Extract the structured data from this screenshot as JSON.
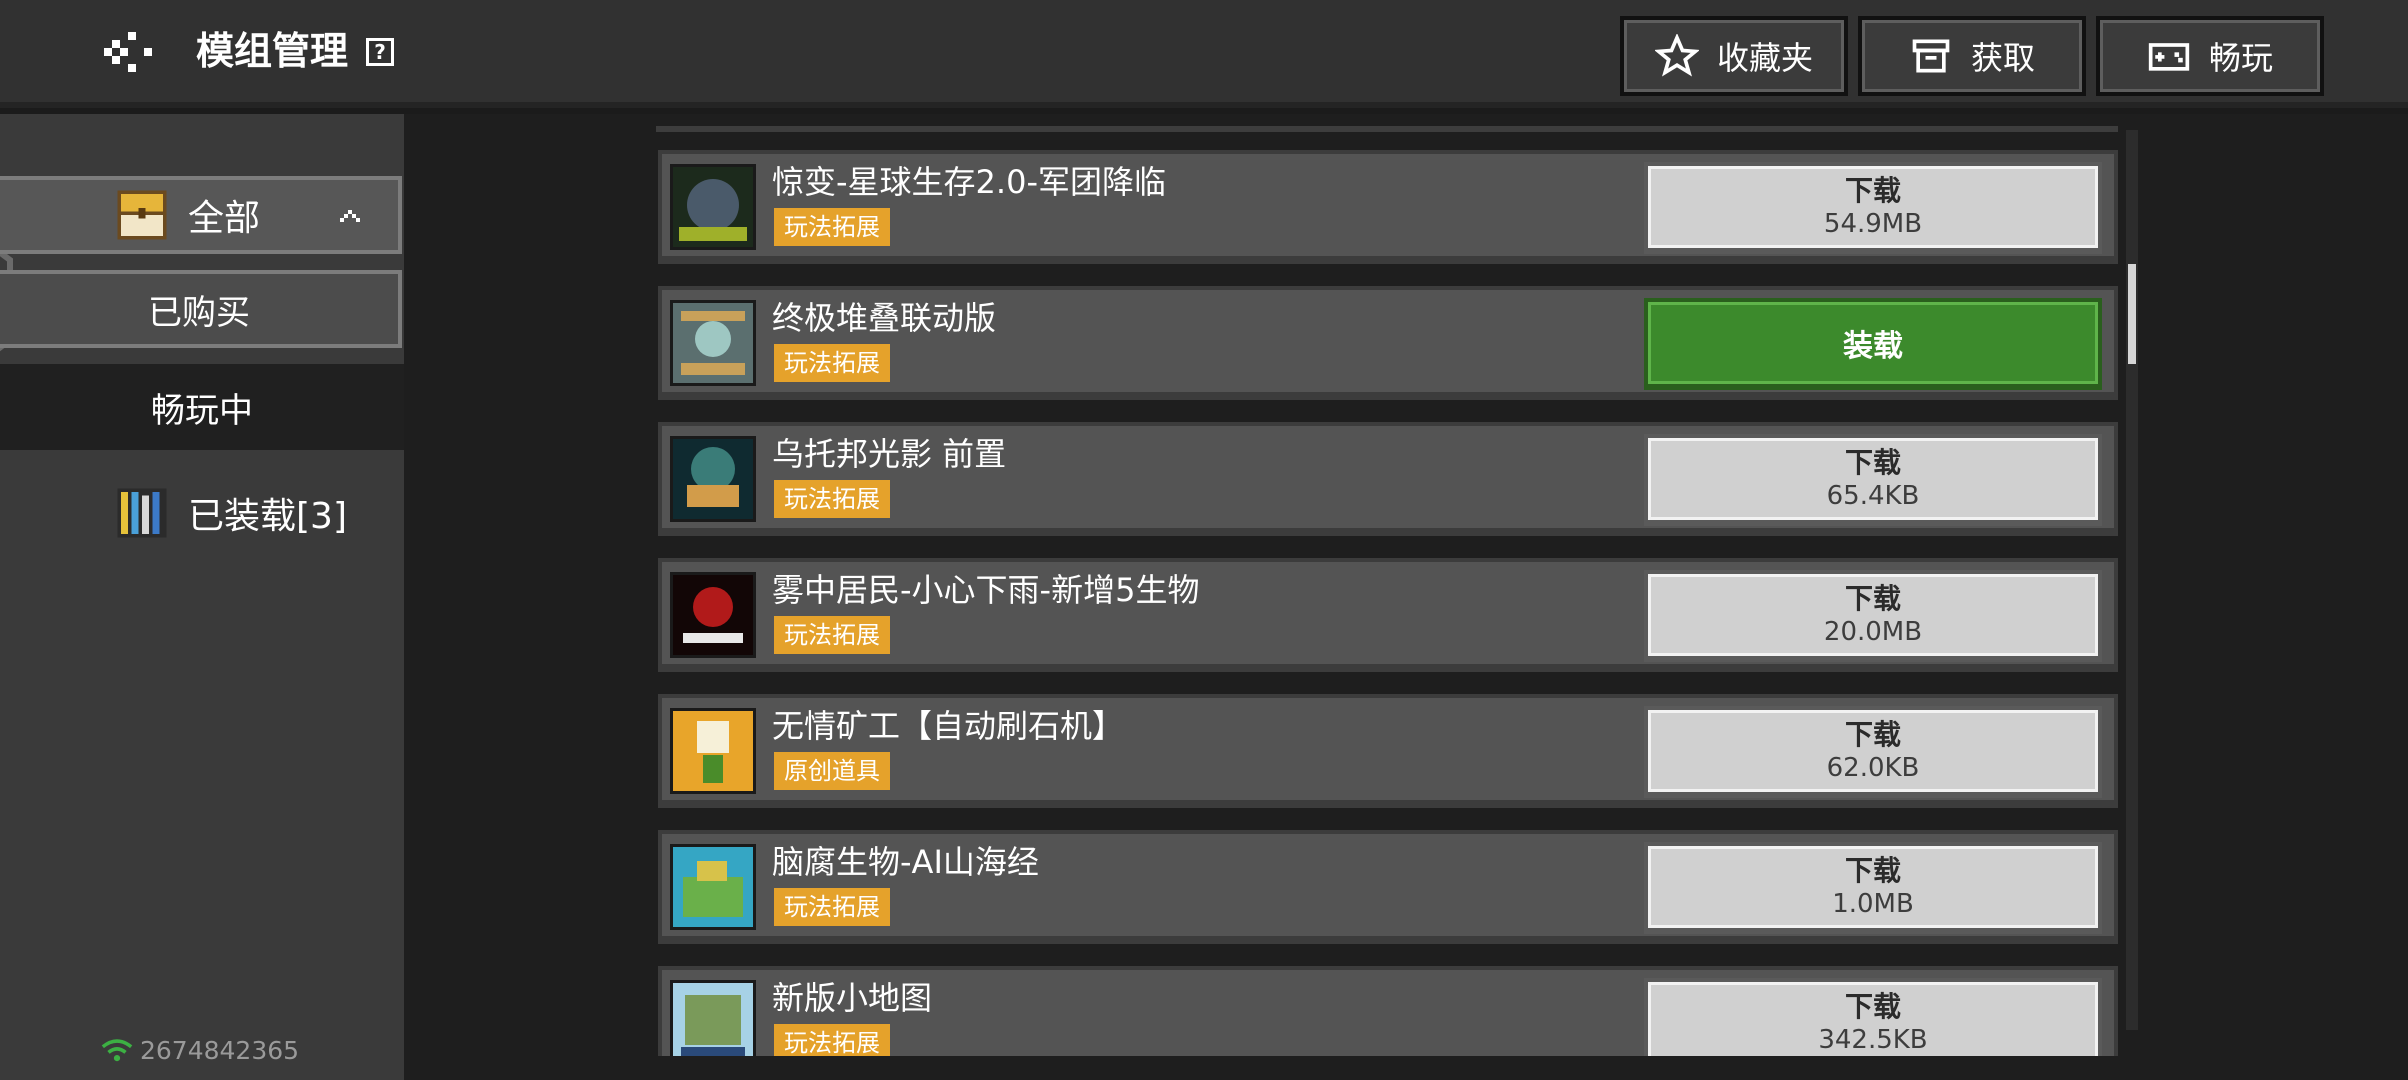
{
  "header": {
    "title": "模组管理",
    "help": "?",
    "buttons": [
      {
        "label": "收藏夹",
        "icon": "star-icon"
      },
      {
        "label": "获取",
        "icon": "store-icon"
      },
      {
        "label": "畅玩",
        "icon": "gamepad-icon"
      }
    ]
  },
  "sidebar": {
    "items": [
      {
        "label": "全部",
        "icon": "chest-icon",
        "expanded": true
      },
      {
        "label": "已购买"
      },
      {
        "label": "畅玩中"
      },
      {
        "label": "已装载[3]",
        "icon": "books-icon"
      }
    ],
    "user_id": "2674842365"
  },
  "mods": [
    {
      "title": "惊变-星球生存2.0-军团降临",
      "tag": "玩法拓展",
      "action": "下载",
      "size": "54.9MB",
      "thumb_colors": [
        "#1c2a1c",
        "#4a5a6a",
        "#9fb02a"
      ]
    },
    {
      "title": "终极堆叠联动版",
      "tag": "玩法拓展",
      "action": "装载",
      "size": "",
      "thumb_colors": [
        "#5b6f6f",
        "#9ec7c2",
        "#c8a15a"
      ]
    },
    {
      "title": "乌托邦光影 前置",
      "tag": "玩法拓展",
      "action": "下载",
      "size": "65.4KB",
      "thumb_colors": [
        "#0f2a30",
        "#3a7c78",
        "#d29c4a"
      ]
    },
    {
      "title": "雾中居民-小心下雨-新增5生物",
      "tag": "玩法拓展",
      "action": "下载",
      "size": "20.0MB",
      "thumb_colors": [
        "#120606",
        "#b11a1a",
        "#e8e8e8"
      ]
    },
    {
      "title": "无情矿工【自动刷石机】",
      "tag": "原创道具",
      "action": "下载",
      "size": "62.0KB",
      "thumb_colors": [
        "#e8a52a",
        "#f6f0d8",
        "#4a8c2a"
      ]
    },
    {
      "title": "脑腐生物-AI山海经",
      "tag": "玩法拓展",
      "action": "下载",
      "size": "1.0MB",
      "thumb_colors": [
        "#35a6c4",
        "#6ab04a",
        "#d7c24a"
      ]
    },
    {
      "title": "新版小地图",
      "tag": "玩法拓展",
      "action": "下载",
      "size": "342.5KB",
      "thumb_colors": [
        "#a7d2e6",
        "#7a9a5a",
        "#2a4a7a"
      ]
    }
  ]
}
